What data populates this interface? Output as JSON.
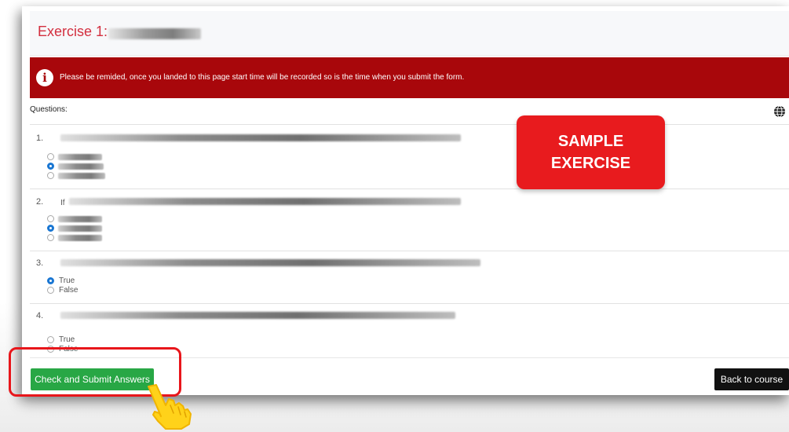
{
  "exercise": {
    "title_label": "Exercise 1:"
  },
  "alert": {
    "icon": "info-icon",
    "glyph": "i",
    "text": "Please be remided, once you landed to this page start time will be recorded so is the time when you submit the form."
  },
  "questions": {
    "label": "Questions:",
    "language_icon": "globe-icon",
    "items": [
      {
        "number": "1.",
        "options": [
          {
            "checked": false
          },
          {
            "checked": true
          },
          {
            "checked": false
          }
        ]
      },
      {
        "number": "2.",
        "prefix": "If",
        "options": [
          {
            "checked": false
          },
          {
            "checked": true
          },
          {
            "checked": false
          }
        ]
      },
      {
        "number": "3.",
        "options": [
          {
            "label": "True",
            "checked": true
          },
          {
            "label": "False",
            "checked": false
          }
        ]
      },
      {
        "number": "4.",
        "options": [
          {
            "label": "True",
            "checked": false
          },
          {
            "label": "False",
            "checked": false
          }
        ]
      }
    ]
  },
  "overlay": {
    "line1": "SAMPLE",
    "line2": "EXERCISE"
  },
  "footer": {
    "submit_label": "Check and Submit Answers",
    "back_label": "Back to course"
  },
  "colors": {
    "alert_bg": "#a8070b",
    "title_red": "#d32f3f",
    "submit_green": "#28a745",
    "back_black": "#111111",
    "overlay_red": "#e81b1e",
    "radio_checked": "#1976d2",
    "highlight": "#e8161b"
  },
  "annotation_icon": "hand-pointer-icon"
}
